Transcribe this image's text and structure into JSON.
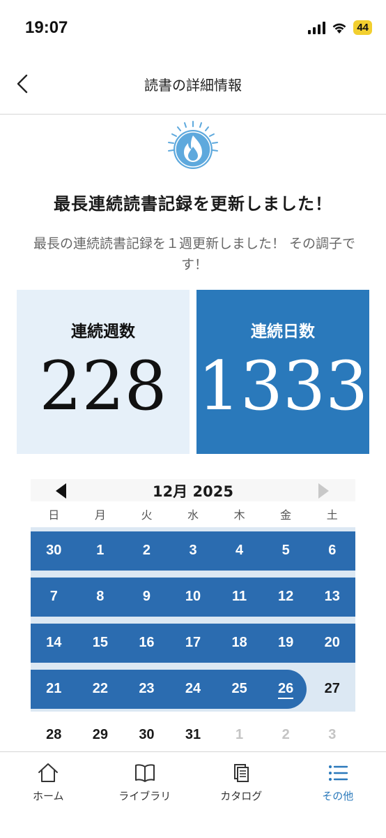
{
  "status_bar": {
    "time": "19:07",
    "battery": "44"
  },
  "header": {
    "title": "読書の詳細情報"
  },
  "headline": "最長連続読書記録を更新しました！",
  "subtext": "最長の連続読書記録を１週更新しました！ その調子です！",
  "stats": {
    "weeks_label": "連続週数",
    "weeks_value": "228",
    "days_label": "連続日数",
    "days_value": "1333"
  },
  "calendar": {
    "month_label": "12月 2025",
    "weekdays": [
      "日",
      "月",
      "火",
      "水",
      "木",
      "金",
      "土"
    ],
    "weeks": [
      [
        "30",
        "1",
        "2",
        "3",
        "4",
        "5",
        "6"
      ],
      [
        "7",
        "8",
        "9",
        "10",
        "11",
        "12",
        "13"
      ],
      [
        "14",
        "15",
        "16",
        "17",
        "18",
        "19",
        "20"
      ],
      [
        "21",
        "22",
        "23",
        "24",
        "25",
        "26",
        "27"
      ],
      [
        "28",
        "29",
        "30",
        "31",
        "1",
        "2",
        "3"
      ]
    ],
    "today": "26"
  },
  "colors": {
    "accent": "#2a79bb",
    "streak_band": "#2b6cb0",
    "card_light": "#e6f0f9",
    "row_light": "#dce8f3"
  },
  "tabs": [
    {
      "label": "ホーム",
      "icon": "home-icon"
    },
    {
      "label": "ライブラリ",
      "icon": "book-icon"
    },
    {
      "label": "カタログ",
      "icon": "catalog-icon"
    },
    {
      "label": "その他",
      "icon": "list-icon"
    }
  ]
}
